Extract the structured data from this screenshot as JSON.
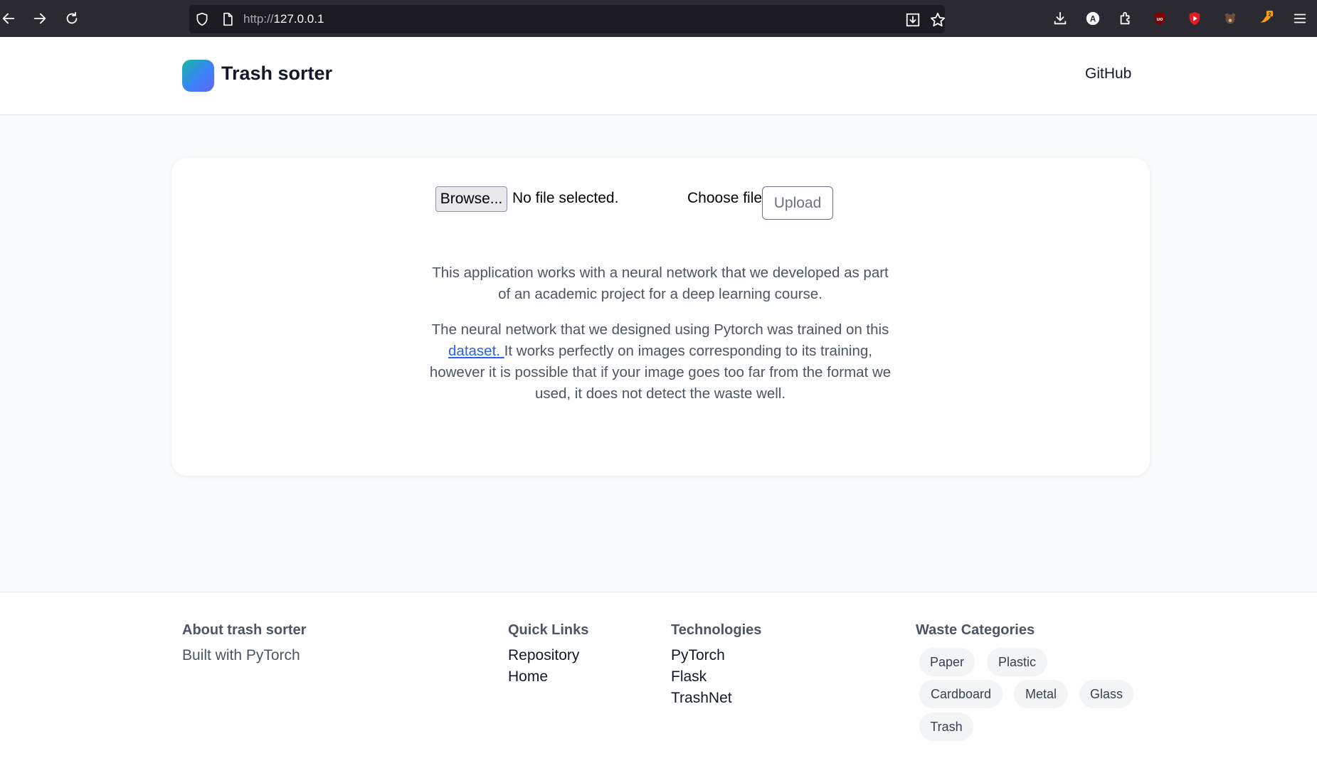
{
  "browser": {
    "url_protocol": "http://",
    "url_host": "127.0.0.1"
  },
  "header": {
    "brand": "Trash sorter",
    "github_link": "GitHub"
  },
  "upload": {
    "browse_label": "Browse...",
    "no_file_text": "No file selected.",
    "choose_label": "Choose file",
    "upload_label": "Upload"
  },
  "description": {
    "paragraph1": "This application works with a neural network that we developed as part of an academic project for a deep learning course.",
    "paragraph2_before": "The neural network that we designed using Pytorch was trained on this ",
    "paragraph2_link": "dataset. ",
    "paragraph2_after": "It works perfectly on images corresponding to its training, however it is possible that if your image goes too far from the format we used, it does not detect the waste well."
  },
  "footer": {
    "about": {
      "heading": "About trash sorter",
      "text": "Built with PyTorch"
    },
    "quick_links": {
      "heading": "Quick Links",
      "items": [
        "Repository",
        "Home"
      ]
    },
    "technologies": {
      "heading": "Technologies",
      "items": [
        "PyTorch",
        "Flask",
        "TrashNet"
      ]
    },
    "waste_categories": {
      "heading": "Waste Categories",
      "items": [
        "Paper",
        "Plastic",
        "Cardboard",
        "Metal",
        "Glass",
        "Trash"
      ]
    }
  },
  "colors": {
    "browser_bar": "#2b2a33",
    "url_field": "#1c1b22",
    "page_bg": "#f9fafb",
    "card_bg": "#ffffff",
    "link": "#2563eb"
  },
  "icons": [
    "back-arrow-icon",
    "forward-arrow-icon",
    "reload-icon",
    "shield-icon",
    "page-icon",
    "save-page-icon",
    "bookmark-star-icon",
    "downloads-icon",
    "account-icon",
    "extensions-icon",
    "ublock-icon",
    "youtube-icon",
    "extension-bear-icon",
    "extension-notify-icon",
    "menu-icon"
  ]
}
